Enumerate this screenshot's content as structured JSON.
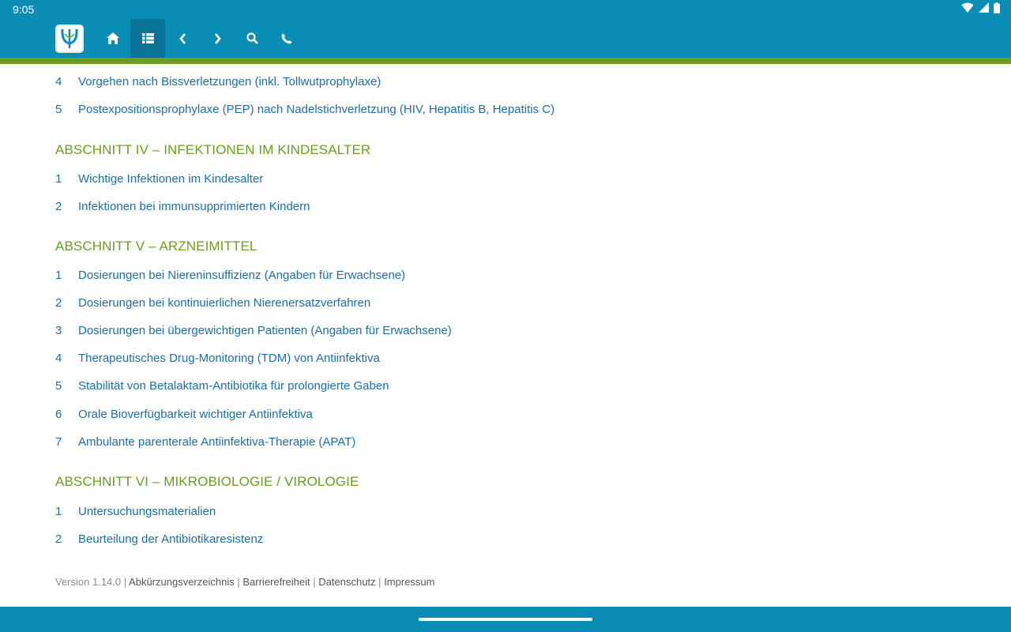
{
  "status_bar": {
    "time": "9:05",
    "icons": [
      "wifi-icon",
      "signal-icon",
      "battery-icon"
    ]
  },
  "toolbar": {
    "logo": "app-logo",
    "buttons": [
      {
        "name": "home-icon",
        "active": false
      },
      {
        "name": "toc-list-icon",
        "active": true
      },
      {
        "name": "chevron-left-icon",
        "active": false
      },
      {
        "name": "chevron-right-icon",
        "active": false
      },
      {
        "name": "search-icon",
        "active": false
      },
      {
        "name": "phone-icon",
        "active": false
      }
    ]
  },
  "colors": {
    "primary": "#0a8db5",
    "accent_green": "#6b9e1f",
    "link_blue": "#1a6fa8",
    "heading_green": "#6a9e1f"
  },
  "toc": {
    "partial_top": [
      {
        "num": "4",
        "label": "Vorgehen nach Bissverletzungen (inkl. Tollwutprophylaxe)"
      },
      {
        "num": "5",
        "label": "Postexpositionsprophylaxe (PEP) nach Nadelstichverletzung (HIV, Hepatitis B, Hepatitis C)"
      }
    ],
    "section4": {
      "title": "ABSCHNITT IV – INFEKTIONEN IM KINDESALTER",
      "items": [
        {
          "num": "1",
          "label": "Wichtige Infektionen im Kindesalter"
        },
        {
          "num": "2",
          "label": "Infektionen bei immunsupprimierten Kindern"
        }
      ]
    },
    "section5": {
      "title": "ABSCHNITT V – ARZNEIMITTEL",
      "items": [
        {
          "num": "1",
          "label": "Dosierungen bei Niereninsuffizienz (Angaben für Erwachsene)"
        },
        {
          "num": "2",
          "label": "Dosierungen bei kontinuierlichen Nierenersatzverfahren"
        },
        {
          "num": "3",
          "label": "Dosierungen bei übergewichtigen Patienten (Angaben für Erwachsene)"
        },
        {
          "num": "4",
          "label": "Therapeutisches Drug-Monitoring (TDM) von Antiinfektiva"
        },
        {
          "num": "5",
          "label": "Stabilität von Betalaktam-Antibiotika für prolongierte Gaben"
        },
        {
          "num": "6",
          "label": "Orale Bioverfügbarkeit wichtiger Antiinfektiva"
        },
        {
          "num": "7",
          "label": "Ambulante parenterale Antiinfektiva-Therapie (APAT)"
        }
      ]
    },
    "section6": {
      "title": "ABSCHNITT VI – MIKROBIOLOGIE / VIROLOGIE",
      "items": [
        {
          "num": "1",
          "label": "Untersuchungsmaterialien"
        },
        {
          "num": "2",
          "label": "Beurteilung der Antibiotikaresistenz"
        }
      ]
    }
  },
  "footer": {
    "version": "Version 1.14.0",
    "separator": "|",
    "links": [
      "Abkürzungsverzeichnis",
      "Barrierefreiheit",
      "Datenschutz",
      "Impressum"
    ]
  }
}
